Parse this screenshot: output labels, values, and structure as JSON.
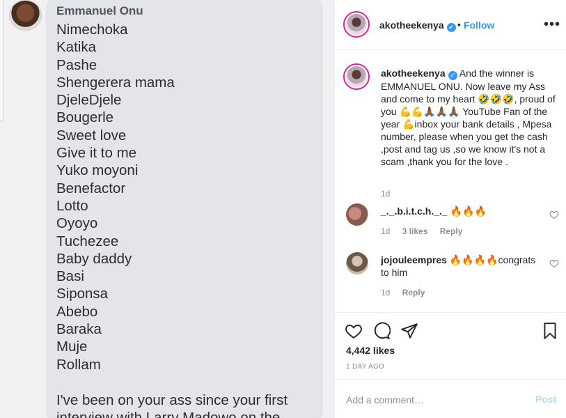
{
  "image": {
    "sender": "Emmanuel Onu",
    "names": [
      "Nimechoka",
      "Katika",
      "Pashe",
      "Shengerera mama",
      "DjeleDjele",
      "Bougerle",
      "Sweet love",
      "Give it to me",
      "Yuko moyoni",
      "Benefactor",
      "Lotto",
      "Oyoyo",
      "Tuchezee",
      "Baby daddy",
      "Basi",
      "Siponsa",
      "Abebo",
      "Baraka",
      "Muje",
      "Rollam"
    ],
    "paragraph": "I've been on your ass since your first interview with Larry Madowo on the"
  },
  "header": {
    "username": "akotheekenya",
    "separator": "•",
    "follow_label": "Follow",
    "more_icon": "more-options-icon"
  },
  "caption": {
    "username": "akotheekenya",
    "text": "And the winner is EMMANUEL ONU. Now leave my Ass and come to my heart 🤣🤣🤣, proud of you 💪💪🙏🏾🙏🏾🙏🏾 YouTube Fan of the year 💪inbox your bank details , Mpesa number, please when you get the cash ,post and tag us ,so we know it's not a scam ,thank you for the love .",
    "time": "1d"
  },
  "comments": [
    {
      "username": "_._.b.i.t.c.h._._",
      "text": "🔥🔥🔥",
      "time": "1d",
      "likes": "3 likes",
      "reply": "Reply"
    },
    {
      "username": "jojouleempres",
      "text": "🔥🔥🔥🔥congrats to him",
      "time": "1d",
      "reply": "Reply"
    }
  ],
  "footer": {
    "likes": "4,442 likes",
    "date": "1 DAY AGO",
    "comment_placeholder": "Add a comment…",
    "post_label": "Post"
  },
  "colors": {
    "accent": "#3897f0",
    "post_disabled": "#b2dffc",
    "muted": "#8e8e8e"
  }
}
